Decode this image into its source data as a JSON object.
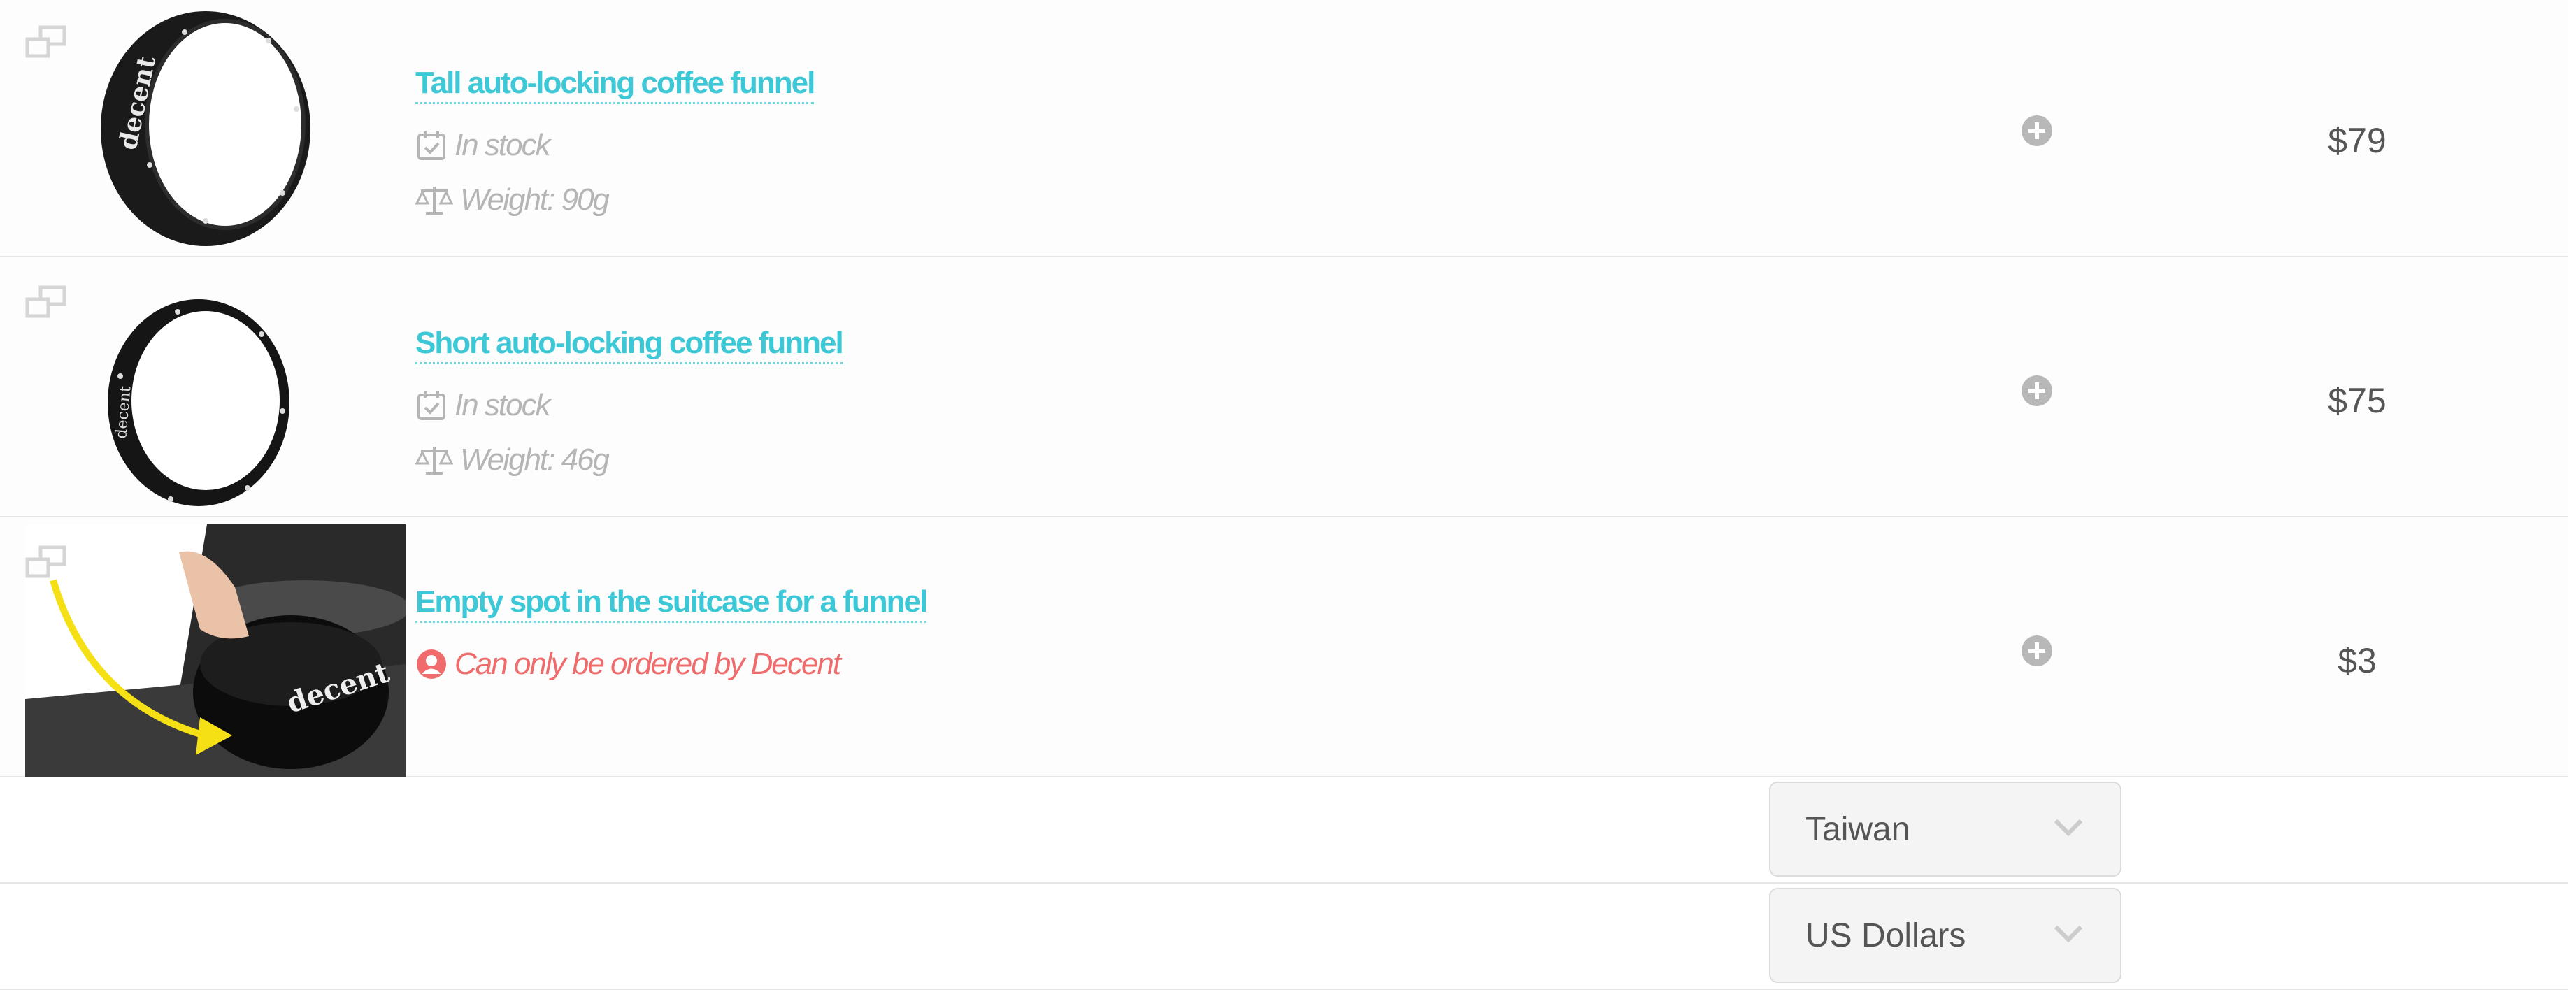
{
  "products": [
    {
      "title": "Tall auto-locking coffee funnel",
      "stock_label": "In stock",
      "weight_label": "Weight: 90g",
      "price": "$79",
      "image_text": "decent",
      "stack_icon": "copy-stack-icon",
      "add_icon": "plus-circle-icon"
    },
    {
      "title": "Short auto-locking coffee funnel",
      "stock_label": "In stock",
      "weight_label": "Weight: 46g",
      "price": "$75",
      "image_text": "decent",
      "stack_icon": "copy-stack-icon",
      "add_icon": "plus-circle-icon"
    },
    {
      "title": "Empty spot in the suitcase for a funnel",
      "restriction_label": "Can only be ordered by Decent",
      "price": "$3",
      "image_text": "decent",
      "stack_icon": "copy-stack-icon",
      "add_icon": "plus-circle-icon"
    }
  ],
  "country_select": {
    "value": "Taiwan"
  },
  "currency_select": {
    "value": "US Dollars"
  },
  "colors": {
    "link": "#3cc8d6",
    "muted": "#b5b5b5",
    "warning": "#f06c6c",
    "arrow": "#f5e016"
  }
}
